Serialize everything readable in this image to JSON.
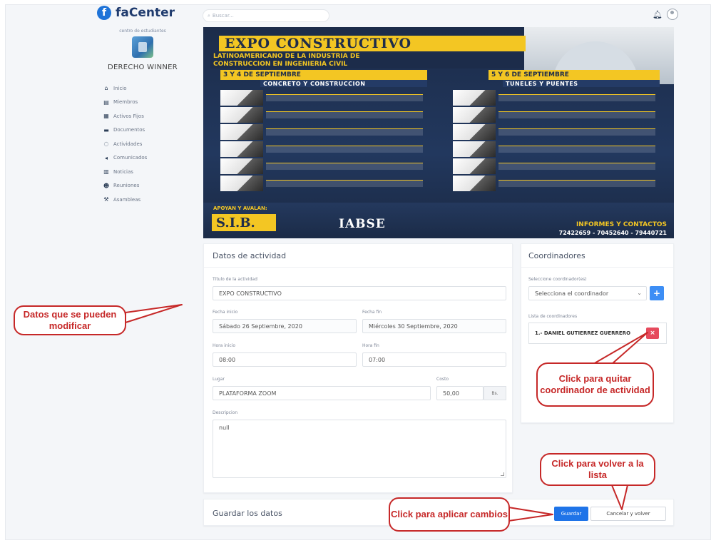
{
  "app": {
    "logo_letter": "f",
    "logo_text": "faCenter",
    "search_placeholder": "Buscar..."
  },
  "sidebar": {
    "center_caption": "centro de estudiantes",
    "org_name": "DERECHO WINNER",
    "items": [
      {
        "label": "Inicio",
        "icon": "home-icon"
      },
      {
        "label": "Miembros",
        "icon": "id-card-icon"
      },
      {
        "label": "Activos Fijos",
        "icon": "boxes-icon"
      },
      {
        "label": "Documentos",
        "icon": "folder-icon"
      },
      {
        "label": "Actividades",
        "icon": "comments-icon"
      },
      {
        "label": "Comunicados",
        "icon": "megaphone-icon"
      },
      {
        "label": "Noticias",
        "icon": "newspaper-icon"
      },
      {
        "label": "Reuniones",
        "icon": "users-icon"
      },
      {
        "label": "Asambleas",
        "icon": "gavel-icon"
      }
    ]
  },
  "banner": {
    "title": "EXPO CONSTRUCTIVO",
    "subtitle1": "LATINOAMERICANO DE LA INDUSTRIA DE",
    "subtitle2": "CONSTRUCCION EN INGENIERIA CIVIL",
    "date1": "3 Y 4 DE SEPTIEMBRE",
    "topic1": "CONCRETO Y CONSTRUCCION",
    "date2": "5 Y 6 DE SEPTIEMBRE",
    "topic2": "TUNELES Y PUENTES",
    "support": "APOYAN Y AVALAN:",
    "logo_sib": "S.I.B.",
    "logo_iabse": "IABSE",
    "info": "INFORMES Y CONTACTOS",
    "phones": "72422659 - 70452640 - 79440721"
  },
  "activity": {
    "card_title": "Datos de actividad",
    "title_label": "Título de la actividad",
    "title_value": "EXPO CONSTRUCTIVO",
    "start_date_label": "Fecha inicio",
    "start_date_value": "Sábado 26 Septiembre, 2020",
    "end_date_label": "Fecha fin",
    "end_date_value": "Miércoles 30 Septiembre, 2020",
    "start_time_label": "Hora inicio",
    "start_time_value": "08:00",
    "end_time_label": "Hora fin",
    "end_time_value": "07:00",
    "place_label": "Lugar",
    "place_value": "PLATAFORMA ZOOM",
    "cost_label": "Costo",
    "cost_value": "50,00",
    "currency": "Bs.",
    "description_label": "Descripcion",
    "description_value": "null"
  },
  "coordinators": {
    "card_title": "Coordinadores",
    "select_label": "Seleccione coordinador(es)",
    "select_value": "Selecciona el coordinador",
    "add_label": "+",
    "list_label": "Lista de coordinadores",
    "list": [
      "1.- DANIEL GUTIERREZ GUERRERO"
    ],
    "remove_label": "×"
  },
  "save": {
    "title": "Guardar los datos",
    "save_label": "Guardar",
    "cancel_label": "Cancelar y volver"
  },
  "callouts": {
    "editable": "Datos que se pueden modificar",
    "remove": "Click para quitar coordinador de actividad",
    "back": "Click para volver a la lista",
    "apply": "Click para aplicar cambios"
  },
  "colors": {
    "primary": "#1f74e8",
    "danger": "#e64a5d",
    "callout": "#c62828",
    "banner_yellow": "#f3c623"
  }
}
